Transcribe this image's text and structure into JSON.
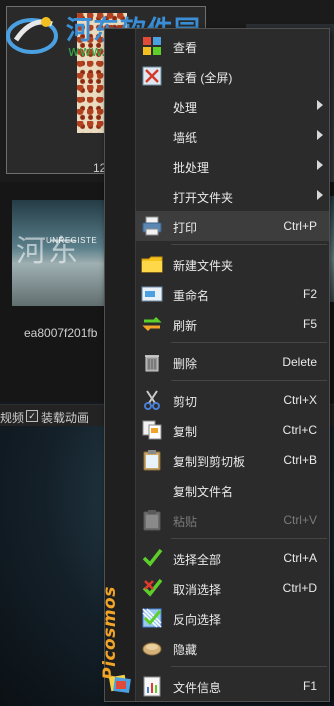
{
  "watermark": {
    "title": "河东软件园",
    "url": "www.pc0359.cn"
  },
  "gallery": {
    "thumb1_caption": "12",
    "thumb2_caption": "ea8007f201fb",
    "thumb2_overlay_text": "河东",
    "thumb2_unregistered": "UNREGISTE"
  },
  "bottombar": {
    "label_left": "规频",
    "checkbox_label": "装载动画",
    "checkbox_checked": "✓"
  },
  "menu": {
    "brand": "Picosmos",
    "items": [
      {
        "label": "查看",
        "shortcut": "",
        "icon": "view-icon"
      },
      {
        "label": "查看 (全屏)",
        "shortcut": "",
        "icon": "fullscreen-icon"
      },
      {
        "label": "处理",
        "shortcut": "",
        "icon": "",
        "submenu": true
      },
      {
        "label": "墙纸",
        "shortcut": "",
        "icon": "",
        "submenu": true
      },
      {
        "label": "批处理",
        "shortcut": "",
        "icon": "",
        "submenu": true
      },
      {
        "label": "打开文件夹",
        "shortcut": "",
        "icon": "",
        "submenu": true
      },
      {
        "label": "打印",
        "shortcut": "Ctrl+P",
        "icon": "printer-icon"
      },
      {
        "label": "新建文件夹",
        "shortcut": "",
        "icon": "folder-icon"
      },
      {
        "label": "重命名",
        "shortcut": "F2",
        "icon": "rename-icon"
      },
      {
        "label": "刷新",
        "shortcut": "F5",
        "icon": "refresh-icon"
      },
      {
        "label": "删除",
        "shortcut": "Delete",
        "icon": "trash-icon"
      },
      {
        "label": "剪切",
        "shortcut": "Ctrl+X",
        "icon": "scissors-icon"
      },
      {
        "label": "复制",
        "shortcut": "Ctrl+C",
        "icon": "copy-icon"
      },
      {
        "label": "复制到剪切板",
        "shortcut": "Ctrl+B",
        "icon": "clipboard-icon"
      },
      {
        "label": "复制文件名",
        "shortcut": "",
        "icon": ""
      },
      {
        "label": "粘贴",
        "shortcut": "Ctrl+V",
        "icon": "paste-icon",
        "disabled": true
      },
      {
        "label": "选择全部",
        "shortcut": "Ctrl+A",
        "icon": "check-icon"
      },
      {
        "label": "取消选择",
        "shortcut": "Ctrl+D",
        "icon": "uncheck-icon"
      },
      {
        "label": "反向选择",
        "shortcut": "",
        "icon": "invert-selection-icon"
      },
      {
        "label": "隐藏",
        "shortcut": "",
        "icon": "hide-icon"
      },
      {
        "label": "文件信息",
        "shortcut": "F1",
        "icon": "file-info-icon"
      }
    ]
  },
  "colors": {
    "menu_bg": "#2b2b2b",
    "highlight": "#3d3d3d",
    "brand": "#f0a428",
    "check_green": "#5ccf2a"
  }
}
